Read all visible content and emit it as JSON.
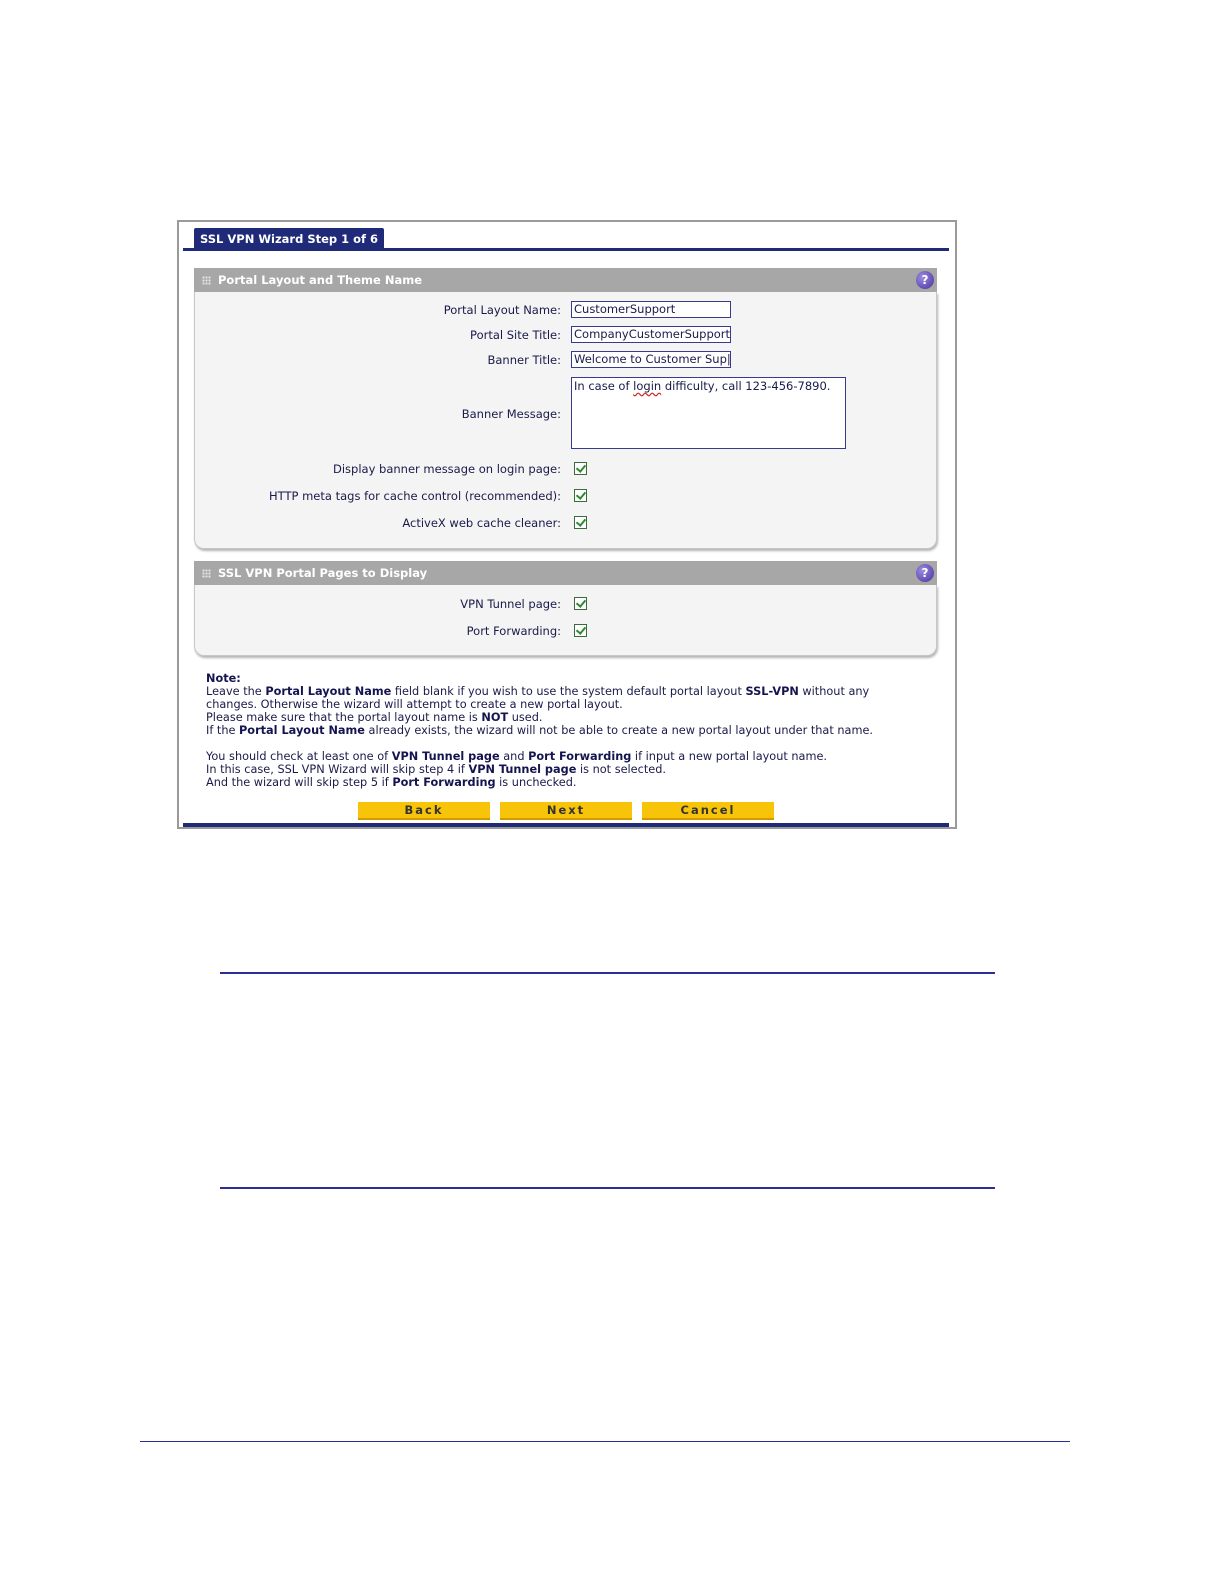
{
  "wizard": {
    "tab_title": "SSL VPN Wizard Step 1 of 6"
  },
  "section_layout": {
    "title": "Portal Layout and Theme Name",
    "portal_layout_name": {
      "label": "Portal Layout Name:",
      "value": "CustomerSupport"
    },
    "portal_site_title": {
      "label": "Portal Site Title:",
      "value": "CompanyCustomerSupport"
    },
    "banner_title": {
      "label": "Banner Title:",
      "value": "Welcome to Customer Sup|"
    },
    "banner_message": {
      "label": "Banner Message:",
      "value_pre": "In case of  ",
      "value_word": "login",
      "value_post": " difficulty, call 123-456-7890."
    },
    "display_banner": {
      "label": "Display banner message on login page:",
      "checked": true
    },
    "http_meta": {
      "label": "HTTP meta tags for cache control (recommended):",
      "checked": true
    },
    "activex": {
      "label": "ActiveX web cache cleaner:",
      "checked": true
    }
  },
  "section_pages": {
    "title": "SSL VPN Portal Pages to Display",
    "vpn_tunnel": {
      "label": "VPN Tunnel page:",
      "checked": true
    },
    "port_forwarding": {
      "label": "Port Forwarding:",
      "checked": true
    }
  },
  "note": {
    "heading": "Note:",
    "l1a": "Leave the ",
    "l1b": "Portal Layout Name",
    "l1c": " field blank if you wish to use the system default portal layout ",
    "l1d": "SSL-VPN",
    "l1e": " without any",
    "l2": "changes. Otherwise the wizard will attempt to create a new portal layout.",
    "l3a": "Please make sure that the portal layout name is ",
    "l3b": "NOT",
    "l3c": " used.",
    "l4a": "If the ",
    "l4b": "Portal Layout Name",
    "l4c": " already exists, the wizard will not be able to create a new portal layout under that name.",
    "l5a": "You should check at least one of ",
    "l5b": "VPN Tunnel page",
    "l5c": " and ",
    "l5d": "Port Forwarding",
    "l5e": " if input a new portal layout name.",
    "l6a": "In this case, SSL VPN Wizard will skip step 4 if ",
    "l6b": "VPN Tunnel page",
    "l6c": " is not selected.",
    "l7a": "And the wizard will skip step 5 if ",
    "l7b": "Port Forwarding",
    "l7c": " is unchecked."
  },
  "buttons": {
    "back": "Back",
    "next": "Next",
    "cancel": "Cancel"
  },
  "colors": {
    "tab": "#1f2a78",
    "section_header": "#a7a7a7",
    "button": "#f7c40a",
    "rule": "#2d2d9a"
  },
  "icons": {
    "help": "help-icon",
    "checkbox": "checkbox-checked-icon",
    "grip": "grip-icon"
  }
}
